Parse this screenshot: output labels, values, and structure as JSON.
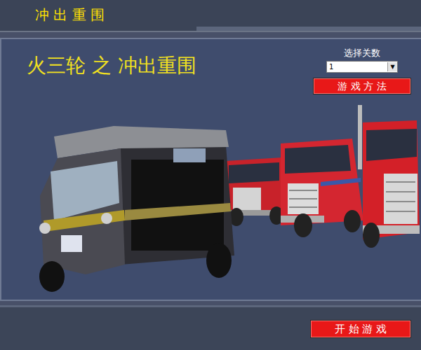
{
  "header": {
    "title": "冲 出 重 围"
  },
  "main": {
    "title": "火三轮 之 冲出重围"
  },
  "level_select": {
    "label": "选择关数",
    "value": "1",
    "arrow": "▼"
  },
  "help_button": {
    "label": "游 戏 方 法"
  },
  "start_button": {
    "label": "开 始 游 戏"
  }
}
